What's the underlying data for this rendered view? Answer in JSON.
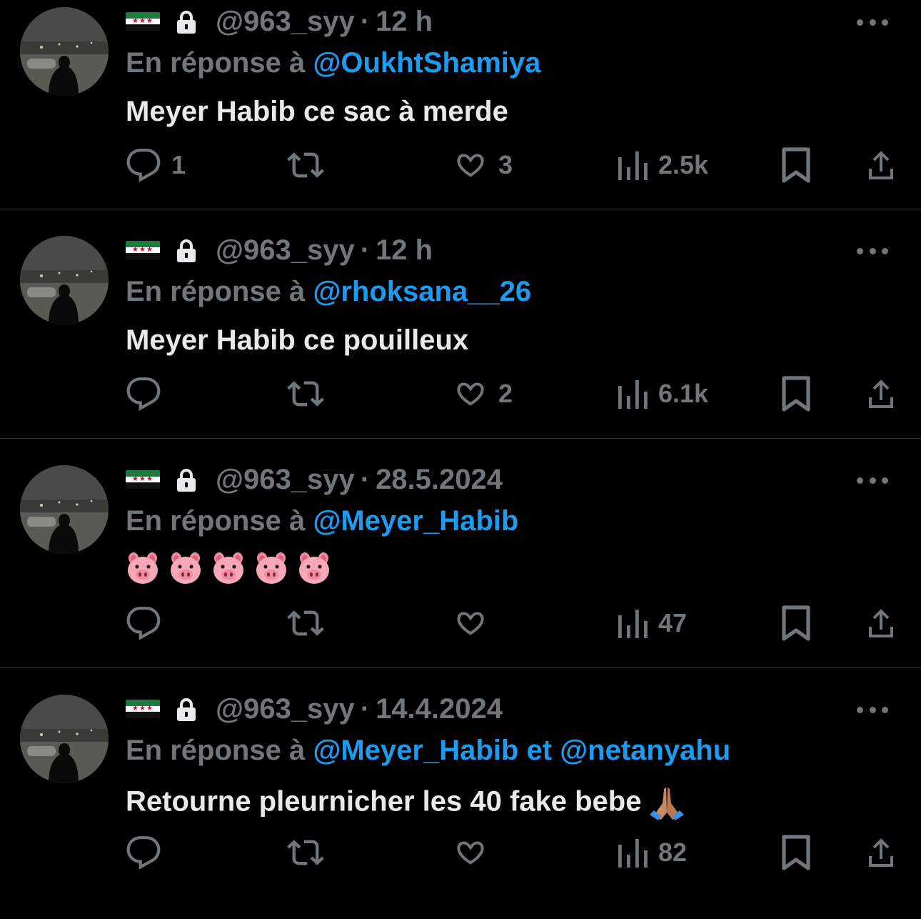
{
  "tweets": [
    {
      "handle": "@963_syy",
      "time": "12 h",
      "reply_prefix": "En réponse à",
      "reply_to": "@OukhtShamiya",
      "reply_extra": "",
      "text": "Meyer Habib ce sac à merde",
      "replies": "1",
      "retweets": "",
      "likes": "3",
      "views": "2.5k"
    },
    {
      "handle": "@963_syy",
      "time": "12 h",
      "reply_prefix": "En réponse à",
      "reply_to": "@rhoksana__26",
      "reply_extra": "",
      "text": "Meyer Habib ce pouilleux",
      "replies": "",
      "retweets": "",
      "likes": "2",
      "views": "6.1k"
    },
    {
      "handle": "@963_syy",
      "time": "28.5.2024",
      "reply_prefix": "En réponse à",
      "reply_to": "@Meyer_Habib",
      "reply_extra": "",
      "text": "",
      "emoji": "🐷🐷🐷🐷🐷",
      "replies": "",
      "retweets": "",
      "likes": "",
      "views": "47"
    },
    {
      "handle": "@963_syy",
      "time": "14.4.2024",
      "reply_prefix": "En réponse à",
      "reply_to": "@Meyer_Habib",
      "reply_extra": "et @netanyahu",
      "text": "Retourne pleurnicher les 40 fake bebe",
      "emoji_end": "🙏🏽",
      "replies": "",
      "retweets": "",
      "likes": "",
      "views": "82"
    }
  ],
  "separator": "·",
  "icons": {
    "flag": "syrian-independence-flag-icon",
    "lock": "lock-icon",
    "more": "more-icon",
    "reply": "reply-icon",
    "retweet": "retweet-icon",
    "like": "heart-icon",
    "views": "views-icon",
    "bookmark": "bookmark-icon",
    "share": "share-icon"
  },
  "colors": {
    "background": "#000000",
    "text": "#e7e9ea",
    "muted": "#71767b",
    "link": "#1d9bf0",
    "divider": "#2f3336"
  }
}
